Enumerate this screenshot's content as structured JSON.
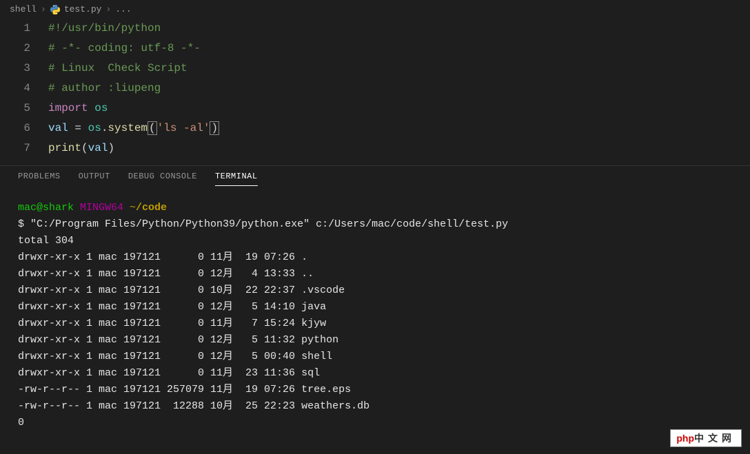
{
  "breadcrumb": {
    "folder": "shell",
    "file": "test.py",
    "tail": "...",
    "sep": "›"
  },
  "editor": {
    "lines": {
      "l1": {
        "num": "1"
      },
      "l2": {
        "num": "2"
      },
      "l3": {
        "num": "3"
      },
      "l4": {
        "num": "4"
      },
      "l5": {
        "num": "5"
      },
      "l6": {
        "num": "6"
      },
      "l7": {
        "num": "7"
      }
    },
    "code": {
      "shebang": "#!/usr/bin/python",
      "coding": "# -*- coding: utf-8 -*-",
      "linux": "# Linux  Check Script",
      "author": "# author :liupeng",
      "import_kw": "import",
      "import_mod": " os",
      "val_var": "val ",
      "eq": "= ",
      "os_mod": "os",
      "dot1": ".",
      "system_fn": "system",
      "lparen": "(",
      "ls_str": "'ls -al'",
      "rparen": ")",
      "print_fn": "print",
      "print_lparen": "(",
      "print_arg": "val",
      "print_rparen": ")"
    }
  },
  "panel": {
    "problems": "PROBLEMS",
    "output": "OUTPUT",
    "debug": "DEBUG CONSOLE",
    "terminal": "TERMINAL"
  },
  "terminal": {
    "prompt": {
      "user": "mac@shark",
      "sys": " MINGW64",
      "tilde": " ~",
      "path": "/code"
    },
    "cmd_prefix": "$ ",
    "cmd": "\"C:/Program Files/Python/Python39/python.exe\" c:/Users/mac/code/shell/test.py",
    "total": "total 304",
    "r1": "drwxr-xr-x 1 mac 197121      0 11月  19 07:26 .",
    "r2": "drwxr-xr-x 1 mac 197121      0 12月   4 13:33 ..",
    "r3": "drwxr-xr-x 1 mac 197121      0 10月  22 22:37 .vscode",
    "r4": "drwxr-xr-x 1 mac 197121      0 12月   5 14:10 java",
    "r5": "drwxr-xr-x 1 mac 197121      0 11月   7 15:24 kjyw",
    "r6": "drwxr-xr-x 1 mac 197121      0 12月   5 11:32 python",
    "r7": "drwxr-xr-x 1 mac 197121      0 12月   5 00:40 shell",
    "r8": "drwxr-xr-x 1 mac 197121      0 11月  23 11:36 sql",
    "r9": "-rw-r--r-- 1 mac 197121 257079 11月  19 07:26 tree.eps",
    "r10": "-rw-r--r-- 1 mac 197121  12288 10月  25 22:23 weathers.db",
    "exit": "0"
  },
  "watermark": {
    "php": "php",
    "rest": "中文网"
  }
}
